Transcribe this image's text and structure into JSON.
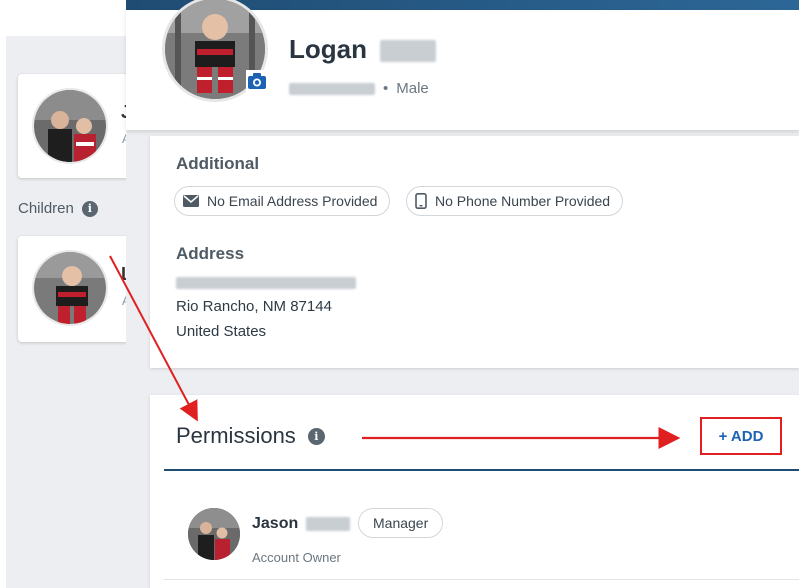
{
  "background_page": {
    "children_label": "Children",
    "card_one": {
      "initial": "J",
      "sub_initial": "A"
    },
    "card_two": {
      "initial": "L",
      "sub_initial": "A"
    }
  },
  "profile": {
    "first_name": "Logan",
    "gender": "Male",
    "separator": "•"
  },
  "additional": {
    "title": "Additional",
    "email_chip": "No Email Address Provided",
    "phone_chip": "No Phone Number Provided"
  },
  "address": {
    "title": "Address",
    "line2": "Rio Rancho, NM 87144",
    "line3": "United States"
  },
  "permissions": {
    "title": "Permissions",
    "add_label": "+ ADD",
    "members": [
      {
        "first_name": "Jason",
        "role": "Manager",
        "subtitle": "Account Owner"
      }
    ]
  },
  "icons": {
    "camera": "camera-icon",
    "info": "info-icon",
    "email": "envelope-icon",
    "phone": "phone-icon"
  },
  "colors": {
    "header_bar": "#1f4c73",
    "accent_link": "#1d63b5",
    "annotation_red": "#e02020",
    "panel_gray": "#eceef1"
  }
}
